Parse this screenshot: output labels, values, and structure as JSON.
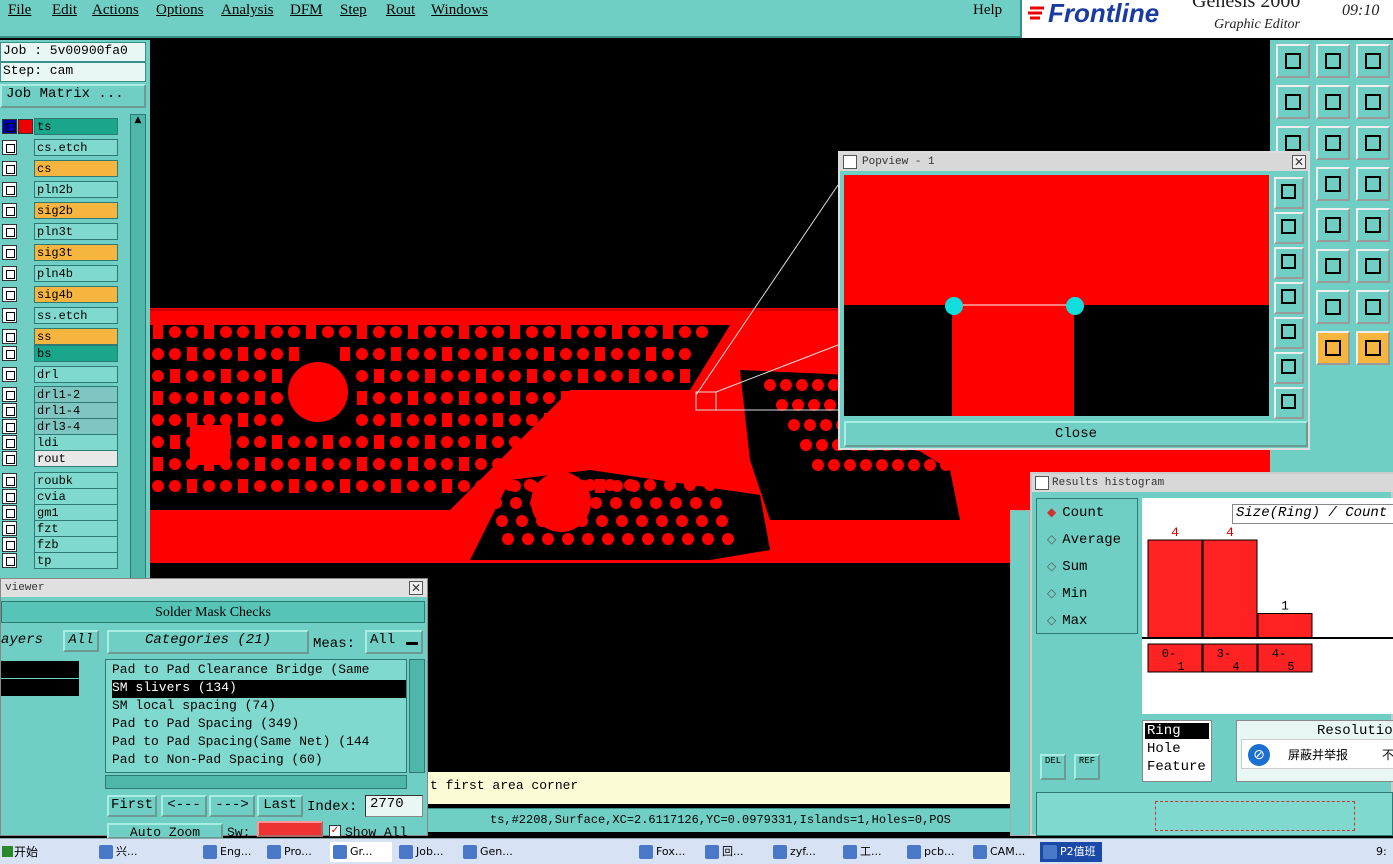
{
  "menu": [
    "File",
    "Edit",
    "Actions",
    "Options",
    "Analysis",
    "DFM",
    "Step",
    "Rout",
    "Windows"
  ],
  "help": "Help",
  "brand": {
    "logo": "Frontline",
    "product": "Genesis 2000",
    "subtitle": "Graphic Editor",
    "time": "09:10"
  },
  "job": {
    "job_label": "Job : 5v00900fa0",
    "step_label": "Step: cam",
    "matrix_button": "Job Matrix ..."
  },
  "layers": [
    {
      "name": "ts",
      "color": "#1aa68a"
    },
    {
      "name": "cs.etch",
      "color": "#7fd9ce"
    },
    {
      "name": "cs",
      "color": "#f6b53f"
    },
    {
      "name": "pln2b",
      "color": "#7fd9ce"
    },
    {
      "name": "sig2b",
      "color": "#f6b53f"
    },
    {
      "name": "pln3t",
      "color": "#7fd9ce"
    },
    {
      "name": "sig3t",
      "color": "#f6b53f"
    },
    {
      "name": "pln4b",
      "color": "#7fd9ce"
    },
    {
      "name": "sig4b",
      "color": "#f6b53f"
    },
    {
      "name": "ss.etch",
      "color": "#7fd9ce"
    },
    {
      "name": "ss",
      "color": "#f6b53f"
    },
    {
      "name": "bs",
      "color": "#1aa68a"
    },
    {
      "name": "drl",
      "color": "#7fd9ce"
    },
    {
      "name": "drl1-2",
      "color": "#7fc6c2"
    },
    {
      "name": "drl1-4",
      "color": "#7fc6c2"
    },
    {
      "name": "drl3-4",
      "color": "#7fc6c2"
    },
    {
      "name": "ldi",
      "color": "#7fd9ce"
    },
    {
      "name": "rout",
      "color": "#e8e8e8"
    },
    {
      "name": "roubk",
      "color": "#7fd9ce"
    },
    {
      "name": "cvia",
      "color": "#7fd9ce"
    },
    {
      "name": "gm1",
      "color": "#7fd9ce"
    },
    {
      "name": "fzt",
      "color": "#7fd9ce"
    },
    {
      "name": "fzb",
      "color": "#7fd9ce"
    },
    {
      "name": "tp",
      "color": "#7fd9ce"
    }
  ],
  "popview": {
    "title": "Popview - 1",
    "close_label": "Close"
  },
  "viewer": {
    "title": "viewer",
    "header": "Solder Mask Checks",
    "layers_label": "ayers",
    "all_button": "All",
    "categories_label": "Categories (21)",
    "meas_label": "Meas:",
    "meas_value": "All",
    "categories": [
      "Pad to Pad Clearance Bridge (Same",
      "SM slivers (134)",
      "SM local spacing (74)",
      "Pad to Pad Spacing (349)",
      "Pad to Pad Spacing(Same Net) (144",
      "Pad to Non-Pad Spacing (60)"
    ],
    "selected_index": 1,
    "first": "First",
    "prev": "<---",
    "next": "--->",
    "last": "Last",
    "index_label": "Index:",
    "index_value": "2770",
    "auto_zoom": "Auto Zoom",
    "sw_label": "Sw:",
    "show_all": "Show All"
  },
  "prompt": "t first area corner",
  "status": "ts,#2208,Surface,XC=2.6117126,YC=0.0979331,Islands=1,Holes=0,POS",
  "histogram": {
    "title": "Results histogram",
    "options": [
      "Count",
      "Average",
      "Sum",
      "Min",
      "Max"
    ],
    "selected": "Count",
    "header": "Size(Ring) / Count",
    "bars": [
      {
        "label_top": "0-",
        "label_bottom": "1",
        "count": 4
      },
      {
        "label_top": "3-",
        "label_bottom": "4",
        "count": 4
      },
      {
        "label_top": "4-",
        "label_bottom": "5",
        "count": 1
      }
    ],
    "list": [
      "Ring",
      "Hole",
      "Feature"
    ],
    "del": "DEL",
    "ref": "REF",
    "resolution": "Resolutio",
    "popup_text": "屏蔽并举报",
    "popup_suffix": "不"
  },
  "taskbar": {
    "start": "开始",
    "tasks": [
      "兴...",
      "Eng...",
      "Pro...",
      "Gr...",
      "Job...",
      "Gen...",
      "Fox...",
      "回...",
      "zyf...",
      "工...",
      "pcb...",
      "CAM...",
      "P2值班"
    ],
    "clock": "9:"
  }
}
